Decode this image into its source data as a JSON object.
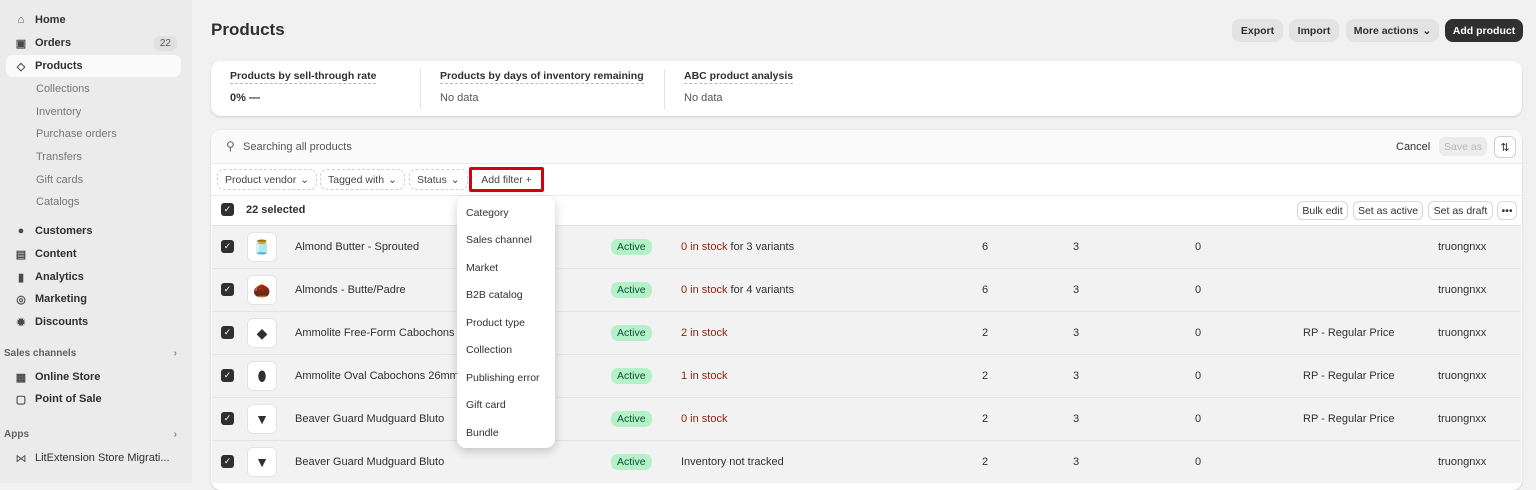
{
  "sidebar": {
    "home": "Home",
    "orders": "Orders",
    "orders_badge": "22",
    "products": "Products",
    "sub": [
      "Collections",
      "Inventory",
      "Purchase orders",
      "Transfers",
      "Gift cards",
      "Catalogs"
    ],
    "customers": "Customers",
    "content": "Content",
    "analytics": "Analytics",
    "marketing": "Marketing",
    "discounts": "Discounts",
    "sales_channels": "Sales channels",
    "online_store": "Online Store",
    "pos": "Point of Sale",
    "apps": "Apps",
    "app1": "LitExtension Store Migrati..."
  },
  "header": {
    "title": "Products",
    "export": "Export",
    "import": "Import",
    "more": "More actions",
    "add": "Add product"
  },
  "metrics": [
    {
      "label": "Products by sell-through rate",
      "value": "0%  —"
    },
    {
      "label": "Products by days of inventory remaining",
      "value": "No data"
    },
    {
      "label": "ABC product analysis",
      "value": "No data"
    }
  ],
  "search": {
    "placeholder": "Searching all products",
    "cancel": "Cancel",
    "save_as": "Save as"
  },
  "filters": {
    "vendor": "Product vendor",
    "tagged": "Tagged with",
    "status": "Status",
    "add": "Add filter +"
  },
  "bulk": {
    "selected": "22 selected",
    "bulk_edit": "Bulk edit",
    "set_active": "Set as active",
    "set_draft": "Set as draft"
  },
  "add_filter_menu": [
    "Category",
    "Sales channel",
    "Market",
    "B2B catalog",
    "Product type",
    "Collection",
    "Publishing error",
    "Gift card",
    "Bundle"
  ],
  "accent": {
    "highlight": "#d4000f",
    "active_badge": "#b4f1c8",
    "stock_red": "#8e1f0b"
  },
  "rows": [
    {
      "name": "Almond Butter - Sprouted",
      "status": "Active",
      "stock": "0 in stock",
      "stock_suffix": " for 3 variants",
      "c1": "6",
      "c2": "3",
      "c3": "0",
      "catalog": "",
      "vendor": "truongnxx"
    },
    {
      "name": "Almonds - Butte/Padre",
      "status": "Active",
      "stock": "0 in stock",
      "stock_suffix": " for 4 variants",
      "c1": "6",
      "c2": "3",
      "c3": "0",
      "catalog": "",
      "vendor": "truongnxx"
    },
    {
      "name": "Ammolite Free-Form Cabochons",
      "status": "Active",
      "stock": "2 in stock",
      "stock_suffix": "",
      "c1": "2",
      "c2": "3",
      "c3": "0",
      "catalog": "RP - Regular Price",
      "vendor": "truongnxx"
    },
    {
      "name": "Ammolite Oval Cabochons 26mm",
      "status": "Active",
      "stock": "1 in stock",
      "stock_suffix": "",
      "c1": "2",
      "c2": "3",
      "c3": "0",
      "catalog": "RP - Regular Price",
      "vendor": "truongnxx"
    },
    {
      "name": "Beaver Guard Mudguard Bluto",
      "status": "Active",
      "stock": "0 in stock",
      "stock_suffix": "",
      "c1": "2",
      "c2": "3",
      "c3": "0",
      "catalog": "RP - Regular Price",
      "vendor": "truongnxx"
    },
    {
      "name": "Beaver Guard Mudguard Bluto",
      "status": "Active",
      "stock": "",
      "stock_suffix": "Inventory not tracked",
      "c1": "2",
      "c2": "3",
      "c3": "0",
      "catalog": "",
      "vendor": "truongnxx"
    }
  ]
}
